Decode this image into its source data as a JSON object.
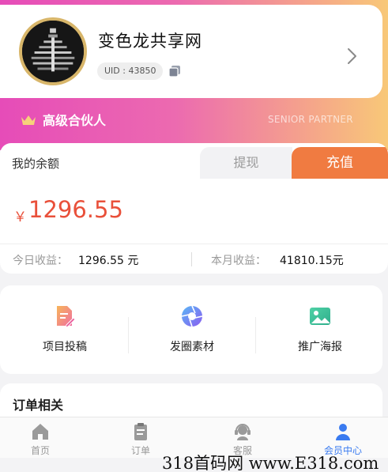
{
  "profile": {
    "name": "变色龙共享网",
    "uid": "UID : 43850",
    "avatar": "avatar-image",
    "copy_icon": "copy-icon",
    "chevron_icon": "chevron-right-icon"
  },
  "membership": {
    "icon": "crown-icon",
    "level": "高级合伙人",
    "level_en": "SENIOR PARTNER"
  },
  "balance": {
    "title": "我的余额",
    "withdraw_label": "提现",
    "recharge_label": "充值",
    "currency": "￥",
    "amount": "1296.55",
    "today_label": "今日收益：",
    "today_value": "1296.55 元",
    "month_label": "本月收益：",
    "month_value": "41810.15元"
  },
  "tools": [
    {
      "label": "项目投稿",
      "icon": "document-edit-icon"
    },
    {
      "label": "发圈素材",
      "icon": "aperture-icon"
    },
    {
      "label": "推广海报",
      "icon": "image-icon"
    }
  ],
  "orders": {
    "title": "订单相关"
  },
  "tabbar": [
    {
      "label": "首页",
      "icon": "home-icon",
      "active": false
    },
    {
      "label": "订单",
      "icon": "clipboard-icon",
      "active": false
    },
    {
      "label": "客服",
      "icon": "headset-icon",
      "active": false
    },
    {
      "label": "会员中心",
      "icon": "user-icon",
      "active": true
    }
  ],
  "watermark": "318首码网 www.E318.com",
  "colors": {
    "accent_orange": "#f07b41",
    "amount_red": "#e9503a",
    "active_blue": "#3a7bf0",
    "gradient_start": "#e64cb8",
    "gradient_end": "#f8c878"
  }
}
